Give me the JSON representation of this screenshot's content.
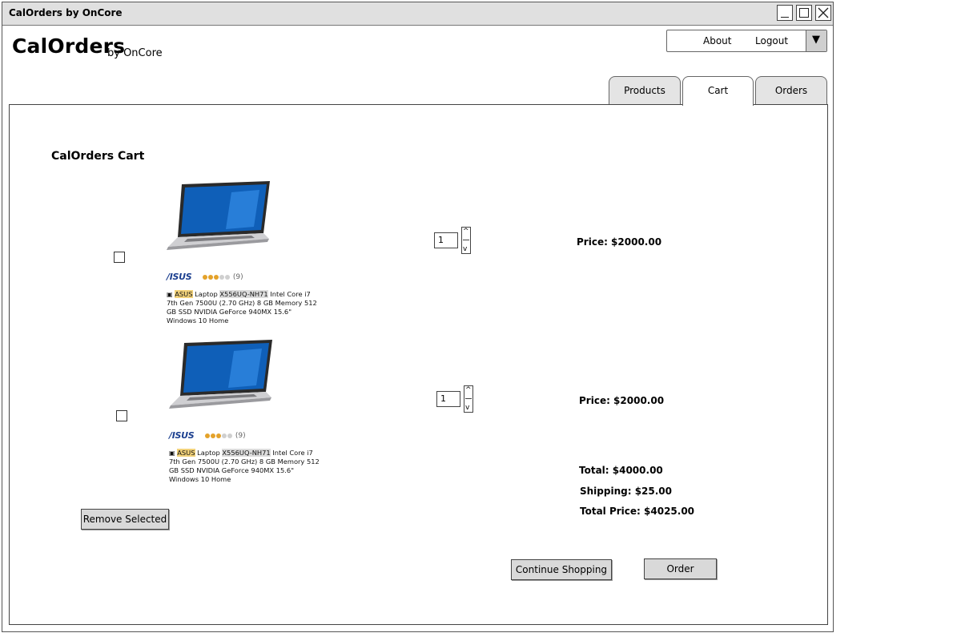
{
  "window": {
    "title": "CalOrders by OnCore"
  },
  "brand": {
    "name": "CalOrders",
    "subtitle": "by OnCore"
  },
  "menu": {
    "items": [
      {
        "label": "About"
      },
      {
        "label": "Logout"
      }
    ],
    "dropdown_glyph": "▼"
  },
  "tabs": [
    {
      "label": "Products",
      "selected": false
    },
    {
      "label": "Cart",
      "selected": true
    },
    {
      "label": "Orders",
      "selected": false
    }
  ],
  "cart": {
    "title": "CalOrders Cart",
    "items": [
      {
        "brand": "/ISUS",
        "rating_count": "(9)",
        "rating_filled": 3,
        "rating_total": 5,
        "desc_hl1": "ASUS",
        "desc_mid1": " Laptop ",
        "desc_hl2": "X556UQ-NH71",
        "desc_rest": " Intel Core i7 7th Gen 7500U (2.70 GHz) 8 GB Memory 512 GB SSD NVIDIA GeForce 940MX 15.6\" Windows 10 Home",
        "quantity": "1",
        "price": "Price: $2000.00"
      },
      {
        "brand": "/ISUS",
        "rating_count": "(9)",
        "rating_filled": 3,
        "rating_total": 5,
        "desc_hl1": "ASUS",
        "desc_mid1": " Laptop ",
        "desc_hl2": "X556UQ-NH71",
        "desc_rest": " Intel Core i7 7th Gen 7500U (2.70 GHz) 8 GB Memory 512 GB SSD NVIDIA GeForce 940MX 15.6\" Windows 10 Home",
        "quantity": "1",
        "price": "Price: $2000.00"
      }
    ],
    "summary": {
      "total": "Total: $4000.00",
      "shipping": "Shipping: $25.00",
      "total_price": "Total Price: $4025.00"
    },
    "buttons": {
      "remove_selected": "Remove Selected",
      "continue_shopping": "Continue Shopping",
      "order": "Order"
    }
  },
  "colors": {
    "titlebar_bg": "#e0e0e0",
    "tab_bg": "#e4e4e4",
    "button_bg": "#d9d9d9",
    "brand_blue": "#1b3f8f",
    "rating_orange": "#e4a22a"
  }
}
